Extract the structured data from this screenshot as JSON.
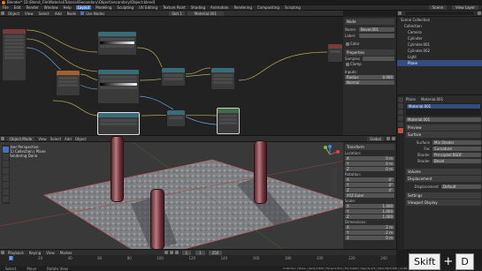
{
  "title_bar": {
    "text": "Blender* [D:\\Blend_File\\Material\\Tutorial\\Secondary\\Object\\secondary\\Object.blend]"
  },
  "menu": {
    "items": [
      "File",
      "Edit",
      "Render",
      "Window",
      "Help"
    ],
    "workspaces": [
      "Layout",
      "Modeling",
      "Sculpting",
      "UV Editing",
      "Texture Paint",
      "Shading",
      "Animation",
      "Rendering",
      "Compositing",
      "Scripting"
    ],
    "active_workspace": "Layout",
    "scene": "Scene",
    "view_layer": "View Layer"
  },
  "node_editor": {
    "header": {
      "object": "Object",
      "view": "View",
      "select": "Select",
      "add": "Add",
      "node": "Node",
      "use_nodes": "Use Nodes",
      "slot": "Slot 1",
      "material": "Material.001"
    }
  },
  "properties_small": {
    "header": "Node",
    "name_label": "Name:",
    "name_value": "Bevel.001",
    "label_label": "Label:",
    "color_label": "Color",
    "properties_title": "Properties",
    "samples_label": "Samples",
    "clamp_label": "Clamp",
    "inputs_title": "Inputs:",
    "radius_label": "Radius",
    "radius_value": "0.000",
    "normal_label": "Normal"
  },
  "outliner": {
    "title": "Scene Collection",
    "items": [
      "Collection",
      "Camera",
      "Cylinder",
      "Cylinder.001",
      "Cylinder.002",
      "Light",
      "Plane"
    ],
    "selected": "Plane"
  },
  "viewport": {
    "header": {
      "mode": "Object Mode",
      "view": "View",
      "select": "Select",
      "add": "Add",
      "object": "Object",
      "shading": "Global"
    },
    "overlay_text": [
      "User Perspective",
      "(1) Collection | Plane",
      "Rendering Done"
    ],
    "n_panel": {
      "title": "Transform",
      "location_label": "Location:",
      "location": {
        "x": "0 m",
        "y": "0 m",
        "z": "0 m"
      },
      "rotation_label": "Rotation:",
      "rotation": {
        "x": "0°",
        "y": "0°",
        "z": "0°"
      },
      "mode": "XYZ Euler",
      "scale_label": "Scale:",
      "scale": {
        "x": "1.000",
        "y": "1.000",
        "z": "1.000"
      },
      "dimensions_label": "Dimensions:",
      "dimensions": {
        "x": "2 m",
        "y": "2 m",
        "z": "0 m"
      }
    }
  },
  "material_props": {
    "object": "Plane",
    "material": "Material.001",
    "slot": "Material.001",
    "sections": [
      "Preview",
      "Surface"
    ],
    "surface_label": "Surface",
    "surface_value": "Principled BSDF",
    "fields": [
      {
        "label": "Surface",
        "value": "Mix Shader"
      },
      {
        "label": "Fac",
        "value": "Curvature"
      },
      {
        "label": "Shader",
        "value": "Principled BSDF"
      },
      {
        "label": "Shader",
        "value": "Bevel"
      }
    ],
    "more": [
      "Volume",
      "Displacement",
      "Settings",
      "Viewport Display"
    ],
    "displacement_label": "Displacement",
    "displacement_value": "Default"
  },
  "timeline": {
    "menus": [
      "Playback",
      "Keying",
      "View",
      "Marker"
    ],
    "start": "1",
    "end": "250",
    "frame": "1",
    "ticks": [
      "0",
      "20",
      "40",
      "60",
      "80",
      "100",
      "120",
      "140",
      "160",
      "180",
      "200",
      "220",
      "240"
    ]
  },
  "status": {
    "text": "Collection | Plane | Verts:2,832 | Faces:2,814 | Tris:5,604 | Objects:1/5 | Mem:58.8 MiB | v2.80.75",
    "left": "Select",
    "mid": "Move",
    "right": "Rotate View"
  },
  "overlay_keys": {
    "key1": "Skift",
    "plus": "+",
    "key2": "D"
  },
  "colors": {
    "accent": "#4772b3",
    "node_green": "#3c6e4a",
    "node_teal": "#3a6b78",
    "node_orange": "#a4602c",
    "node_red": "#7a3a3a"
  }
}
